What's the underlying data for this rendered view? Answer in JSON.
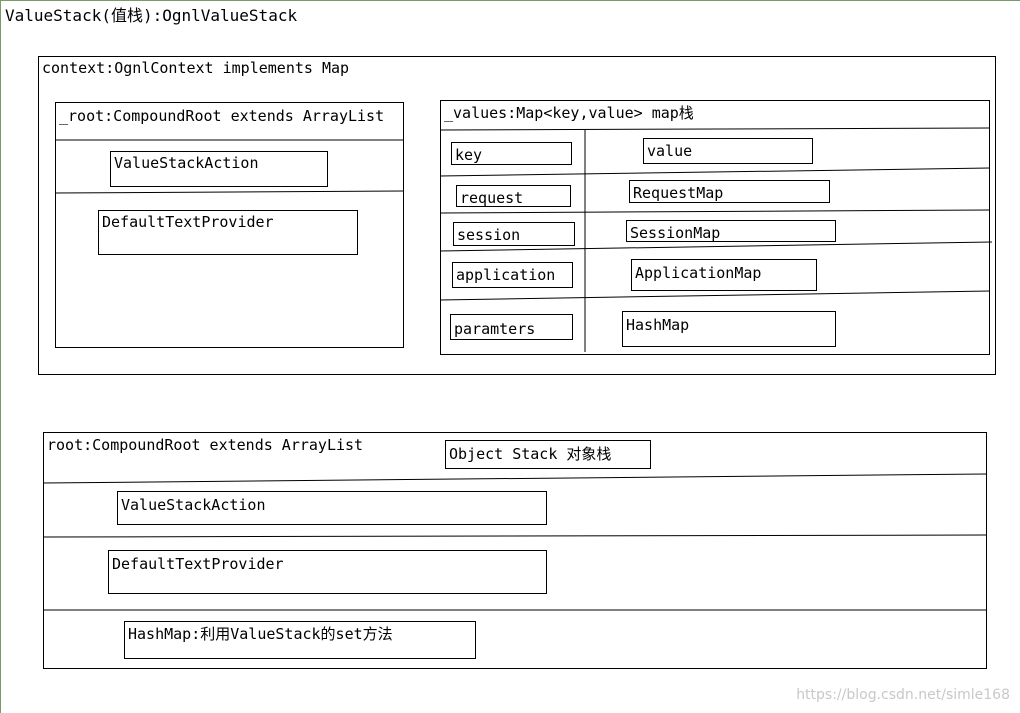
{
  "title": "ValueStack(值栈):OgnlValueStack",
  "context": {
    "label": "context:OgnlContext implements Map",
    "root": {
      "label": "_root:CompoundRoot extends ArrayList",
      "items": [
        "ValueStackAction",
        "DefaultTextProvider"
      ]
    },
    "values": {
      "label": "_values:Map<key,value>  map栈",
      "rows": [
        {
          "key": "key",
          "value": "value"
        },
        {
          "key": "request",
          "value": "RequestMap"
        },
        {
          "key": "session",
          "value": "SessionMap"
        },
        {
          "key": "application",
          "value": "ApplicationMap"
        },
        {
          "key": "paramters",
          "value": "HashMap"
        }
      ]
    }
  },
  "root_stack": {
    "label": "root:CompoundRoot extends ArrayList",
    "badge": "Object Stack 对象栈",
    "items": [
      "ValueStackAction",
      "DefaultTextProvider",
      "HashMap:利用ValueStack的set方法"
    ]
  },
  "watermark": "https://blog.csdn.net/simle168"
}
